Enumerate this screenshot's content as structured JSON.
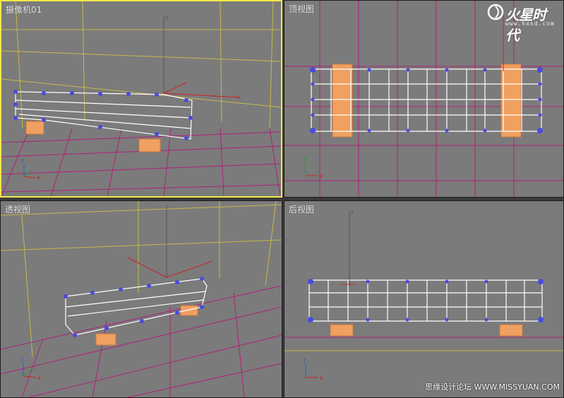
{
  "viewports": {
    "camera": {
      "label": "摄像机01"
    },
    "top": {
      "label": "顶视图"
    },
    "perspective": {
      "label": "透视图"
    },
    "back": {
      "label": "后视图"
    }
  },
  "branding": {
    "name": "火星时代",
    "url": "www.hxsd.com",
    "mark": "logo-swirl"
  },
  "watermark": {
    "text": "思缘设计论坛 WWW.MISSYUAN.COM"
  },
  "colors": {
    "viewport_bg": "#7b7b7b",
    "active_border": "#f1e84a",
    "grid": "#b0207a",
    "wall_grid": "#c8b84a",
    "mesh_vertex": "#4a4ae0",
    "mesh_edge": "#ffffff",
    "legs": "#f0a060",
    "axis_x": "#d02020",
    "axis_y": "#20a020",
    "axis_z": "#2060d0"
  },
  "axes": {
    "x": "x",
    "y": "y",
    "z": "z"
  }
}
